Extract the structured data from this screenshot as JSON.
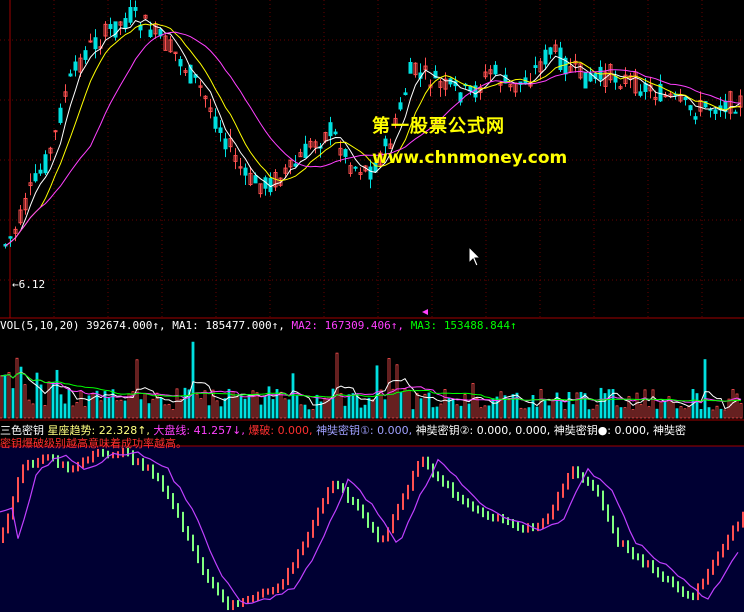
{
  "colors": {
    "up": "#ff5050",
    "down": "#00e0e0",
    "ma_short": "#ffffff",
    "ma_mid": "#ffff00",
    "ma_long": "#ff40ff",
    "vol_ma2": "#ff40ff",
    "vol_ma3": "#00ff00",
    "osc_line": "#c040ff",
    "osc_green": "#80ff80",
    "grid": "#6a0000",
    "bottom_bg": "#000033"
  },
  "watermark": {
    "line1": "第一股票公式网",
    "line2": "www.chnmoney.com"
  },
  "price_panel": {
    "low_marker": "6.12"
  },
  "vol_panel": {
    "label": "VOL(5,10,20)",
    "value": "392674.000↑,",
    "ma1_label": "MA1:",
    "ma1_value": "185477.000↑,",
    "ma2_label": "MA2:",
    "ma2_value": "167309.406↑,",
    "ma3_label": "MA3:",
    "ma3_value": "153488.844↑"
  },
  "osc_panel": {
    "title": "三色密钥",
    "trend_label": "星座趋势:",
    "trend_value": "22.328↑,",
    "market_label": "大盘线:",
    "market_value": "41.257↓,",
    "burst_label": "爆破:",
    "burst_value": "0.000,",
    "key1_label": "神奘密钥①:",
    "key1_value": "0.000,",
    "key2_label": "神奘密钥②:",
    "key2_value": "0.000, 0.000,",
    "key3_label": "神奘密钥●:",
    "key3_value": "0.000,",
    "key4_label": "神奘密",
    "note": "密钥爆破级别越高意味着成功率越高。"
  },
  "chart_data": {
    "type": "candlestick",
    "series": [
      {
        "name": "VOL",
        "value": 392674.0
      },
      {
        "name": "MA1",
        "value": 185477.0
      },
      {
        "name": "MA2",
        "value": 167309.406
      },
      {
        "name": "MA3",
        "value": 153488.844
      },
      {
        "name": "星座趋势",
        "value": 22.328
      },
      {
        "name": "大盘线",
        "value": 41.257
      },
      {
        "name": "爆破",
        "value": 0.0
      },
      {
        "name": "神奘密钥①",
        "value": 0.0
      },
      {
        "name": "神奘密钥②",
        "value": 0.0
      },
      {
        "name": "神奘密钥●",
        "value": 0.0
      }
    ],
    "price_low_marker": 6.12
  }
}
